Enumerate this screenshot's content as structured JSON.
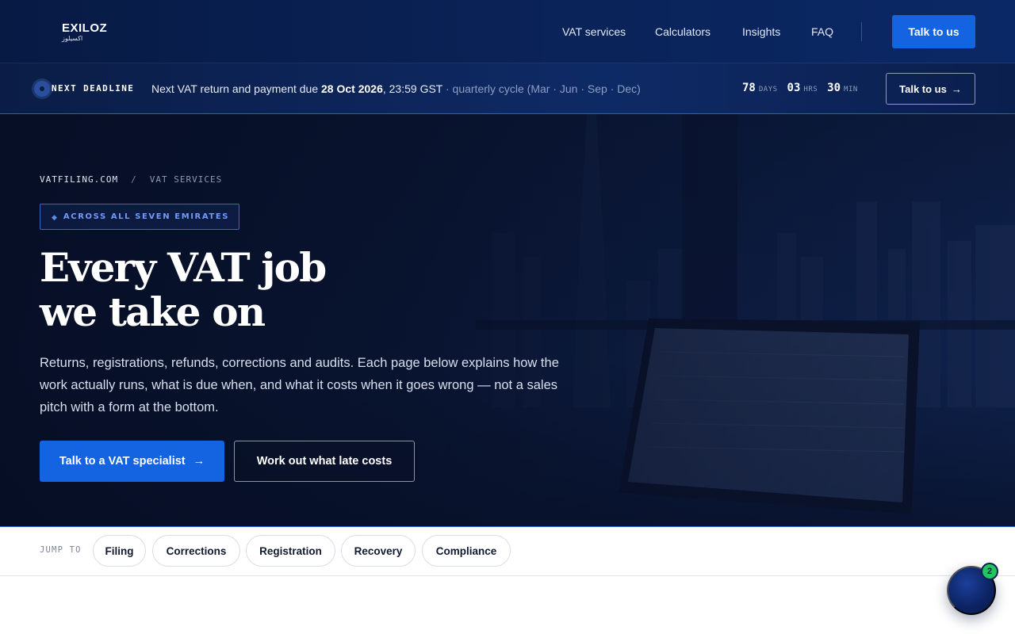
{
  "brand": {
    "name": "EXILOZ",
    "name_ar": "اكسيلوز"
  },
  "nav": {
    "links": [
      "VAT services",
      "Calculators",
      "Insights",
      "FAQ"
    ],
    "cta": "Talk to us"
  },
  "deadline": {
    "label": "NEXT DEADLINE",
    "text_prefix": "Next VAT return and payment due ",
    "date": "28 Oct 2026",
    "time": ", 23:59 GST",
    "cycle": " · quarterly cycle (Mar · Jun · Sep · Dec)",
    "countdown": [
      {
        "value": "78",
        "unit": "DAYS"
      },
      {
        "value": "03",
        "unit": "HRS"
      },
      {
        "value": "30",
        "unit": "MIN"
      }
    ],
    "cta": "Talk to us",
    "cta_arrow": "→"
  },
  "hero": {
    "breadcrumb": [
      "VATFILING.COM",
      "/",
      "VAT SERVICES"
    ],
    "badge_icon": "◆",
    "badge": "ACROSS ALL SEVEN EMIRATES",
    "headline_line1": "Every VAT job",
    "headline_line2": "we take on",
    "lede": "Returns, registrations, refunds, corrections and audits. Each page below explains how the work actually runs, what is due when, and what it costs when it goes wrong — not a sales pitch with a form at the bottom.",
    "primary_cta": "Talk to a VAT specialist",
    "primary_cta_arrow": "→",
    "secondary_cta": "Work out what late costs"
  },
  "jump": {
    "label": "JUMP TO",
    "chips": [
      "Filing",
      "Corrections",
      "Registration",
      "Recovery",
      "Compliance"
    ]
  },
  "chat": {
    "badge_count": "2"
  },
  "colors": {
    "accent": "#1463e0",
    "navy": "#0a2358",
    "badge_green": "#22c55e"
  }
}
